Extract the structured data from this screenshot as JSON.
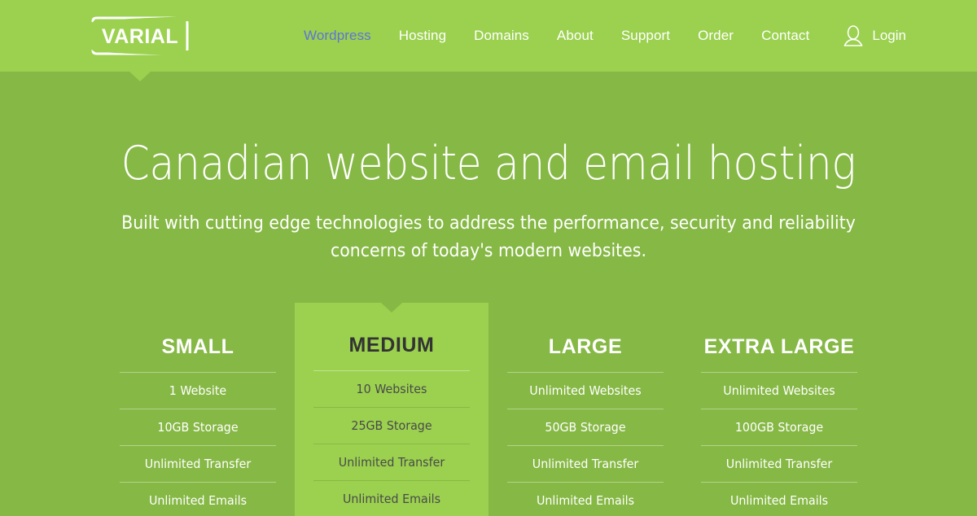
{
  "brand": {
    "logo_text": "VARIAL",
    "header_bg": "#9bd14f",
    "hero_bg": "#86b845",
    "accent_blue": "#5f74d6"
  },
  "nav": {
    "items": [
      {
        "label": "Wordpress",
        "active": true
      },
      {
        "label": "Hosting",
        "active": false
      },
      {
        "label": "Domains",
        "active": false
      },
      {
        "label": "About",
        "active": false
      },
      {
        "label": "Support",
        "active": false
      },
      {
        "label": "Order",
        "active": false
      },
      {
        "label": "Contact",
        "active": false
      }
    ],
    "login": {
      "label": "Login",
      "icon": "user-icon"
    }
  },
  "hero": {
    "title": "Canadian website and email hosting",
    "subtitle": "Built with cutting edge technologies to address the performance, security and reliability concerns of today's modern websites."
  },
  "pricing": {
    "plans": [
      {
        "name": "SMALL",
        "featured": false,
        "features": [
          "1 Website",
          "10GB Storage",
          "Unlimited Transfer",
          "Unlimited Emails"
        ]
      },
      {
        "name": "MEDIUM",
        "featured": true,
        "features": [
          "10 Websites",
          "25GB Storage",
          "Unlimited Transfer",
          "Unlimited Emails"
        ]
      },
      {
        "name": "LARGE",
        "featured": false,
        "features": [
          "Unlimited Websites",
          "50GB Storage",
          "Unlimited Transfer",
          "Unlimited Emails"
        ]
      },
      {
        "name": "EXTRA LARGE",
        "featured": false,
        "features": [
          "Unlimited Websites",
          "100GB Storage",
          "Unlimited Transfer",
          "Unlimited Emails"
        ]
      }
    ]
  }
}
